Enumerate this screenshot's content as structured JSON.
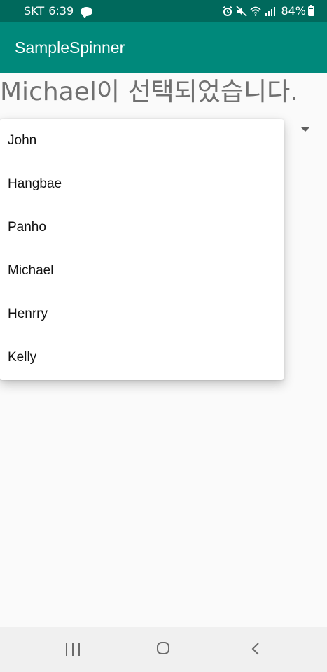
{
  "status_bar": {
    "carrier": "SKT",
    "time": "6:39",
    "battery": "84%",
    "battery_level": 0.84,
    "notification_icon": "kakaotalk-icon",
    "right_icons": [
      "alarm-icon",
      "mute-icon",
      "wifi-icon",
      "signal-icon"
    ]
  },
  "app_bar": {
    "title": "SampleSpinner",
    "color": "#00897b"
  },
  "main": {
    "selection_text": "Michael이 선택되었습니다."
  },
  "spinner": {
    "options": [
      "John",
      "Hangbae",
      "Panho",
      "Michael",
      "Henrry",
      "Kelly"
    ]
  },
  "nav_bar": {
    "buttons": [
      "recents-icon",
      "home-icon",
      "back-icon"
    ]
  }
}
